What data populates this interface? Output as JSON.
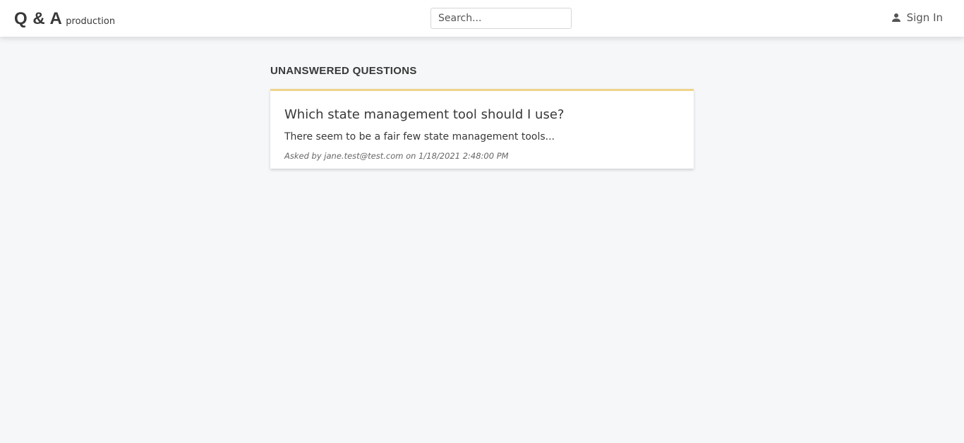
{
  "header": {
    "brand_name": "Q & A",
    "brand_env": "production",
    "search_placeholder": "Search...",
    "signin_label": "Sign In",
    "signin_icon": "user-icon"
  },
  "main": {
    "title": "UNANSWERED QUESTIONS",
    "questions": [
      {
        "title": "Which state management tool should I use?",
        "content": "There seem to be a fair few state management tools...",
        "meta": "Asked by jane.test@test.com on 1/18/2021 2:48:00 PM"
      }
    ]
  },
  "colors": {
    "background": "#f6f7f9",
    "card_accent": "#f0d48c",
    "header_bg": "#ffffff",
    "text": "#383838"
  }
}
